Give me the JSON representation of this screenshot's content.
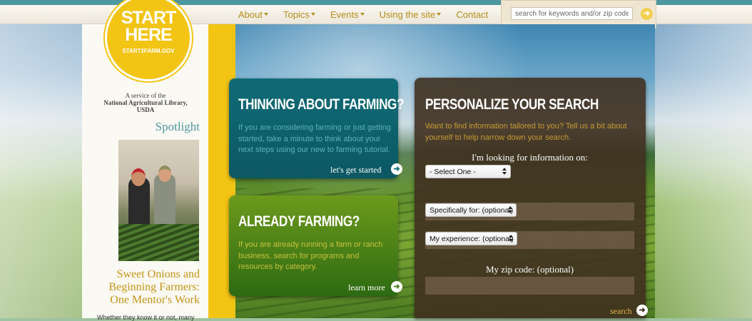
{
  "nav": {
    "items": [
      {
        "label": "About",
        "dropdown": true
      },
      {
        "label": "Topics",
        "dropdown": true
      },
      {
        "label": "Events",
        "dropdown": true
      },
      {
        "label": "Using the site",
        "dropdown": true
      },
      {
        "label": "Contact",
        "dropdown": false
      }
    ],
    "search_placeholder": "search for keywords and/or zip code",
    "search_button_icon": "arrow-right-icon"
  },
  "logo": {
    "line1": "START",
    "line2": "HERE",
    "line3": "START2FARM.GOV"
  },
  "sidebar": {
    "service_line1": "A service of the",
    "service_line2": "National Agricultural Library,",
    "service_line3": "USDA",
    "spotlight_heading": "Spotlight",
    "story_title": "Sweet Onions and Beginning Farmers: One Mentor's Work",
    "story_blurb": "Whether they know it or not, many"
  },
  "thinking_card": {
    "title": "THINKING ABOUT FARMING?",
    "body": "If you are considering farming or just getting started, take a minute to think about your next steps using our new to farming tutorial.",
    "link": "let's get started"
  },
  "already_card": {
    "title": "ALREADY FARMING?",
    "body": "If you are already running a farm or ranch business, search for programs and resources by category.",
    "link": "learn more"
  },
  "personalize": {
    "title": "PERSONALIZE YOUR SEARCH",
    "intro": "Want to find information tailored to you? Tell us a bit about yourself to help narrow down your search.",
    "looking_label": "I'm looking for information on:",
    "select_topic": "- Select One -",
    "select_for": "Specifically for: (optional)",
    "select_experience": "My experience: (optional)",
    "zip_label": "My zip code: (optional)",
    "search_label": "search"
  },
  "colors": {
    "teal": "#0f6b77",
    "green": "#6d9a1c",
    "gold": "#f2c414",
    "nav_text": "#b48d18"
  }
}
